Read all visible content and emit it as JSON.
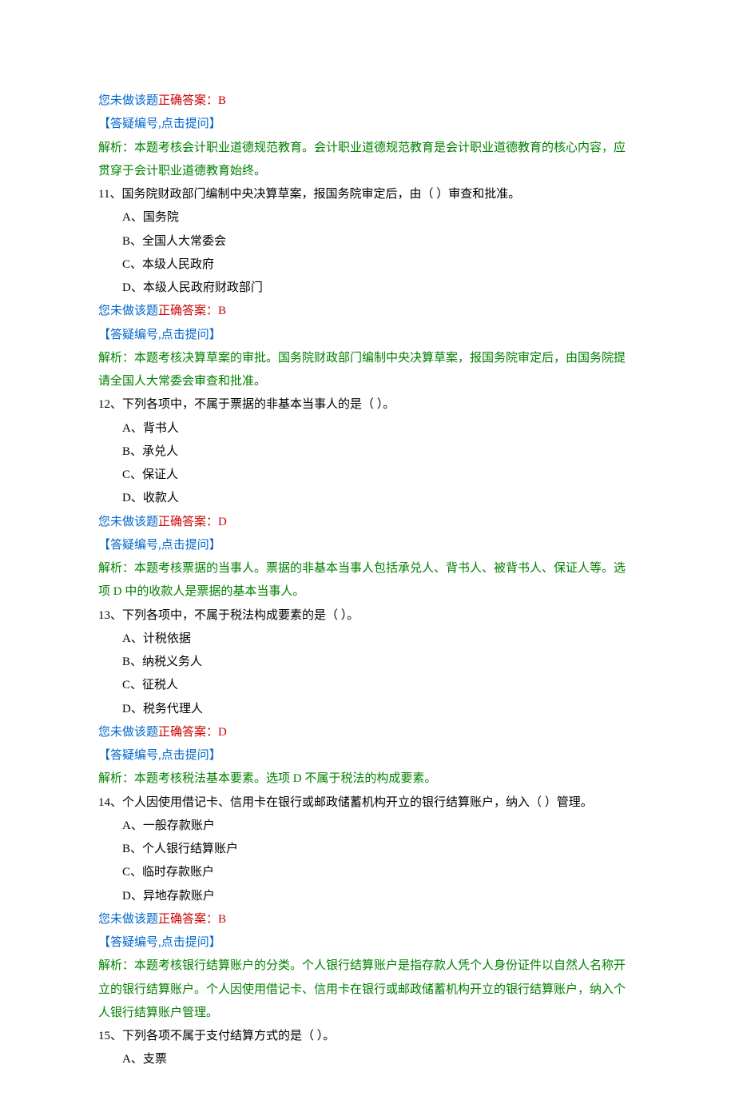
{
  "strings": {
    "not_answered": "您未做该题",
    "correct_prefix": "正确答案：",
    "ask_link": "【答疑编号,点击提问】",
    "analysis_label": "解析："
  },
  "questions": [
    {
      "id": "q10",
      "correct": "B",
      "analysis": "本题考核会计职业道德规范教育。会计职业道德规范教育是会计职业道德教育的核心内容，应贯穿于会计职业道德教育始终。"
    },
    {
      "id": "q11",
      "number": "11、",
      "stem": "国务院财政部门编制中央决算草案，报国务院审定后，由（ ）审查和批准。",
      "options": [
        "A、国务院",
        "B、全国人大常委会",
        "C、本级人民政府",
        "D、本级人民政府财政部门"
      ],
      "correct": "B",
      "analysis": "本题考核决算草案的审批。国务院财政部门编制中央决算草案，报国务院审定后，由国务院提请全国人大常委会审查和批准。"
    },
    {
      "id": "q12",
      "number": "12、",
      "stem": "下列各项中，不属于票据的非基本当事人的是（ ）。",
      "options": [
        "A、背书人",
        "B、承兑人",
        "C、保证人",
        "D、收款人"
      ],
      "correct": "D",
      "analysis": "本题考核票据的当事人。票据的非基本当事人包括承兑人、背书人、被背书人、保证人等。选项 D 中的收款人是票据的基本当事人。"
    },
    {
      "id": "q13",
      "number": "13、",
      "stem": "下列各项中，不属于税法构成要素的是（ ）。",
      "options": [
        "A、计税依据",
        "B、纳税义务人",
        "C、征税人",
        "D、税务代理人"
      ],
      "correct": "D",
      "analysis": "本题考核税法基本要素。选项 D 不属于税法的构成要素。"
    },
    {
      "id": "q14",
      "number": "14、",
      "stem": "个人因使用借记卡、信用卡在银行或邮政储蓄机构开立的银行结算账户，纳入（ ）管理。",
      "options": [
        "A、一般存款账户",
        "B、个人银行结算账户",
        "C、临时存款账户",
        "D、异地存款账户"
      ],
      "correct": "B",
      "analysis": "本题考核银行结算账户的分类。个人银行结算账户是指存款人凭个人身份证件以自然人名称开立的银行结算账户。个人因使用借记卡、信用卡在银行或邮政储蓄机构开立的银行结算账户，纳入个人银行结算账户管理。"
    },
    {
      "id": "q15",
      "number": "15、",
      "stem": "下列各项不属于支付结算方式的是（ ）。",
      "options": [
        "A、支票"
      ]
    }
  ]
}
